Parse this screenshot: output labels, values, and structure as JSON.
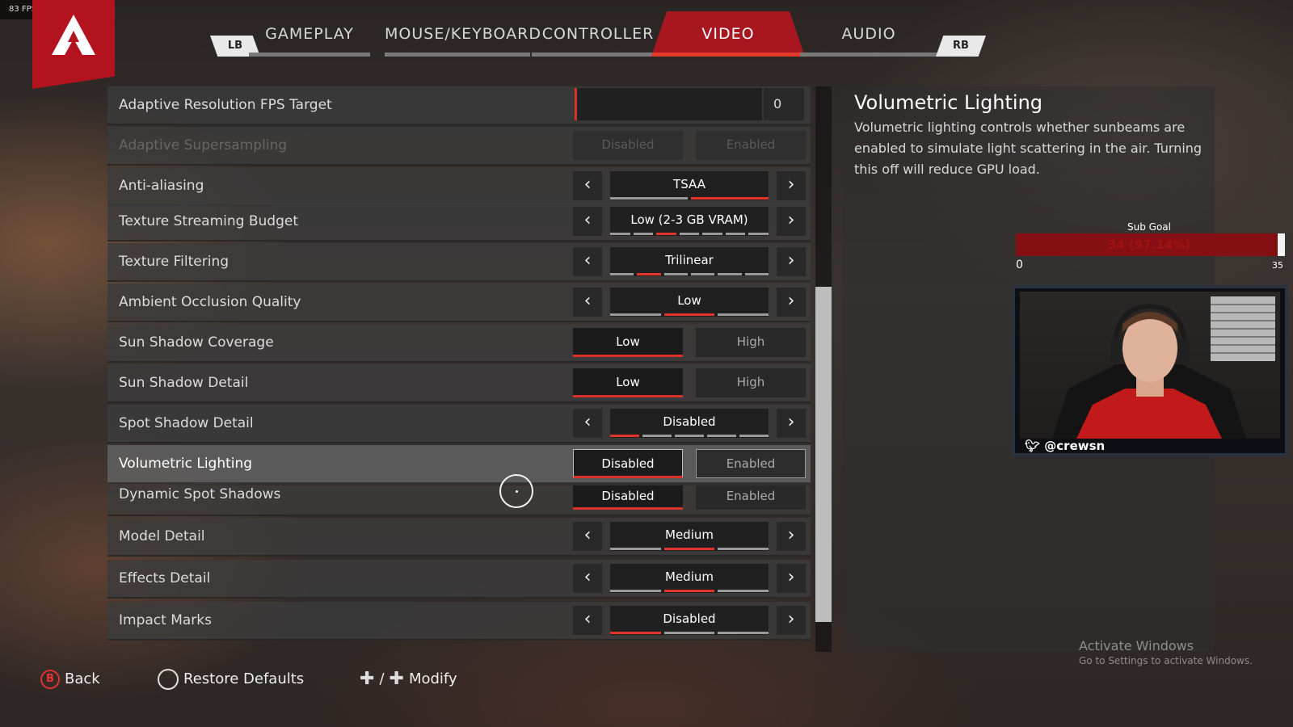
{
  "fps_counter": "83 FPS",
  "tabs": [
    "GAMEPLAY",
    "MOUSE/KEYBOARD",
    "CONTROLLER",
    "VIDEO",
    "AUDIO"
  ],
  "active_tab": "VIDEO",
  "bumpers": {
    "left": "LB",
    "right": "RB"
  },
  "settings": {
    "adaptive_fps": {
      "label": "Adaptive Resolution FPS Target",
      "value": "0",
      "fill": 0.01
    },
    "adaptive_supersampling": {
      "label": "Adaptive Supersampling",
      "opt1": "Disabled",
      "opt2": "Enabled"
    },
    "anti_aliasing": {
      "label": "Anti-aliasing",
      "value": "TSAA"
    },
    "texture_budget": {
      "label": "Texture Streaming Budget",
      "value": "Low (2-3 GB VRAM)"
    },
    "texture_filtering": {
      "label": "Texture Filtering",
      "value": "Trilinear"
    },
    "ambient_occlusion": {
      "label": "Ambient Occlusion Quality",
      "value": "Low"
    },
    "sun_shadow_coverage": {
      "label": "Sun Shadow Coverage",
      "opt1": "Low",
      "opt2": "High"
    },
    "sun_shadow_detail": {
      "label": "Sun Shadow Detail",
      "opt1": "Low",
      "opt2": "High"
    },
    "spot_shadow_detail": {
      "label": "Spot Shadow Detail",
      "value": "Disabled"
    },
    "volumetric_lighting": {
      "label": "Volumetric Lighting",
      "opt1": "Disabled",
      "opt2": "Enabled"
    },
    "dynamic_spot_shadows": {
      "label": "Dynamic Spot Shadows",
      "opt1": "Disabled",
      "opt2": "Enabled"
    },
    "model_detail": {
      "label": "Model Detail",
      "value": "Medium"
    },
    "effects_detail": {
      "label": "Effects Detail",
      "value": "Medium"
    },
    "impact_marks": {
      "label": "Impact Marks",
      "value": "Disabled"
    }
  },
  "description": {
    "title": "Volumetric Lighting",
    "body": "Volumetric lighting controls whether sunbeams are enabled to simulate light scattering in the air. Turning this off will reduce GPU load."
  },
  "sub_goal": {
    "label": "Sub Goal",
    "text": "34 (97.14%)",
    "progress": 0.9714,
    "min": "0",
    "max": "35"
  },
  "webcam": {
    "handle": "@crewsn"
  },
  "footer": {
    "back": "Back",
    "back_key": "B",
    "restore": "Restore Defaults",
    "modify": "Modify",
    "modify_sep": "/"
  },
  "watermark": {
    "line1": "Activate Windows",
    "line2": "Go to Settings to activate Windows."
  },
  "colors": {
    "accent_red": "#d9302a",
    "tab_red": "#a81620"
  }
}
